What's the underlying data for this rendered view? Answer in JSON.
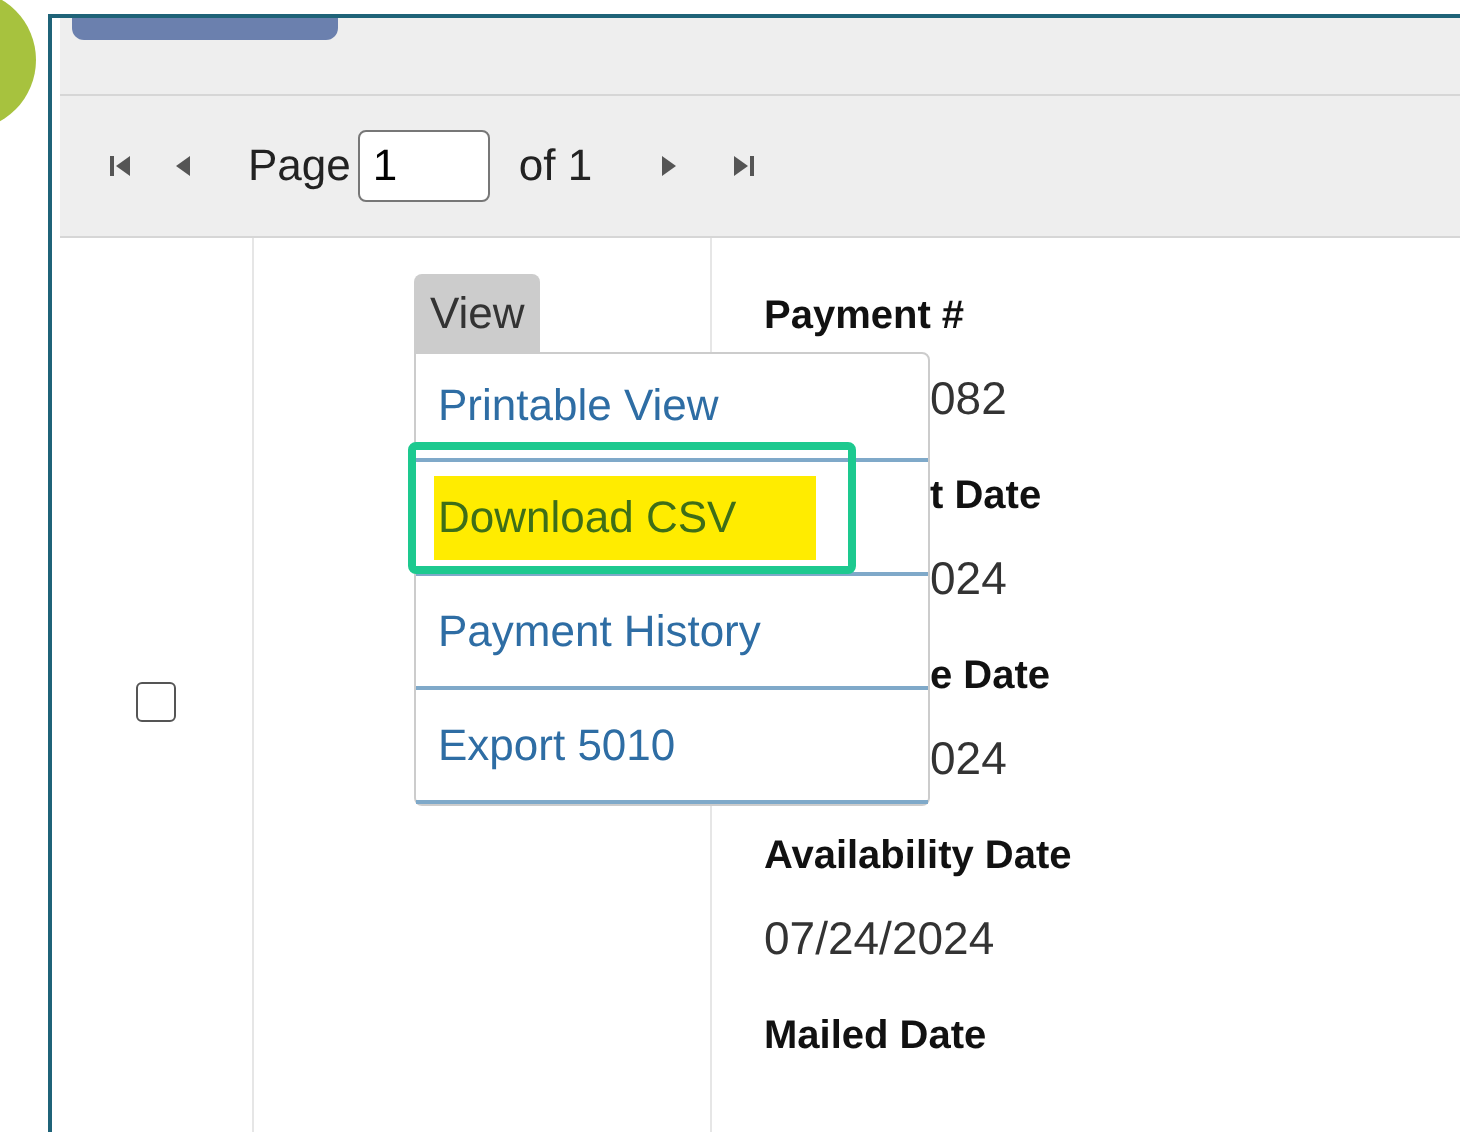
{
  "pager": {
    "page_label": "Page",
    "page_value": "1",
    "of_label": "of 1"
  },
  "row": {
    "checked": false,
    "view_button": "View",
    "menu": [
      {
        "label": "Printable View",
        "highlighted": false
      },
      {
        "label": "Download CSV",
        "highlighted": true
      },
      {
        "label": "Payment History",
        "highlighted": false
      },
      {
        "label": "Export 5010",
        "highlighted": false
      }
    ],
    "fields": [
      {
        "text": "Payment #",
        "kind": "label"
      },
      {
        "text": "082",
        "kind": "value"
      },
      {
        "text": "t Date",
        "kind": "label"
      },
      {
        "text": "024",
        "kind": "value"
      },
      {
        "text": "e Date",
        "kind": "label"
      },
      {
        "text": "024",
        "kind": "value"
      },
      {
        "text": "Availability Date",
        "kind": "label"
      },
      {
        "text": "07/24/2024",
        "kind": "value"
      },
      {
        "text": "Mailed Date",
        "kind": "label"
      }
    ]
  }
}
